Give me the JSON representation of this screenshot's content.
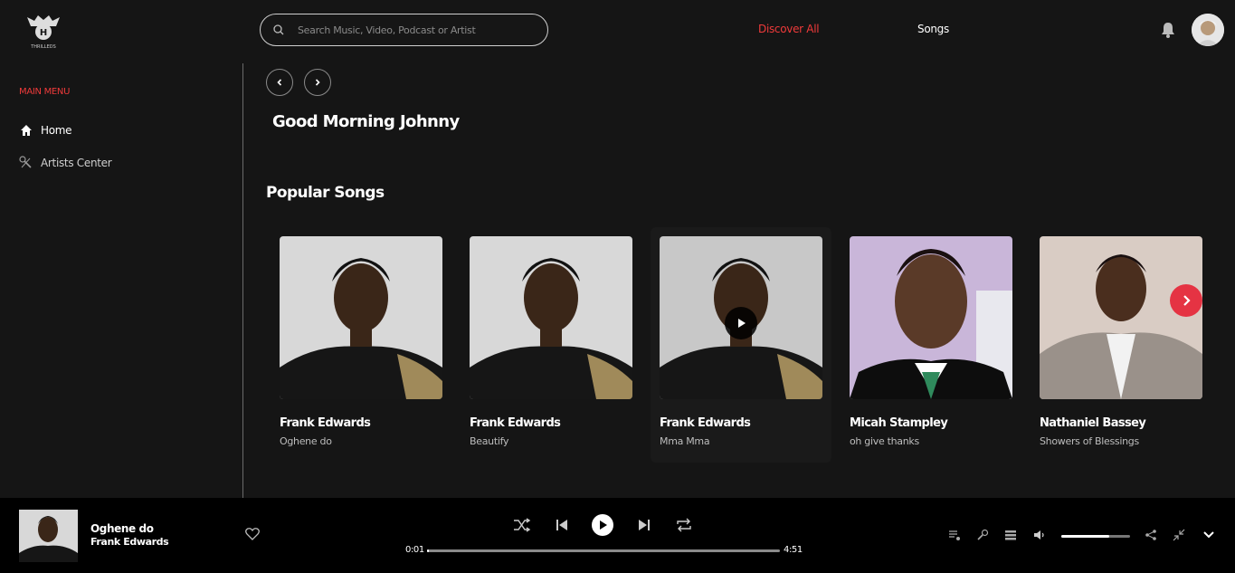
{
  "header": {
    "logo_text": "THRILLEDS",
    "search_placeholder": "Search Music, Video, Podcast or Artist",
    "nav": [
      {
        "label": "Discover All",
        "active": true
      },
      {
        "label": "Songs",
        "active": false
      }
    ]
  },
  "sidebar": {
    "menu_title": "MAIN MENU",
    "items": [
      {
        "label": "Home",
        "icon": "home-icon"
      },
      {
        "label": "Artists Center",
        "icon": "artists-icon"
      }
    ]
  },
  "main": {
    "greeting": "Good Morning Johnny",
    "popular_title": "Popular Songs",
    "songs": [
      {
        "artist": "Frank Edwards",
        "title": "Oghene do"
      },
      {
        "artist": "Frank Edwards",
        "title": "Beautify"
      },
      {
        "artist": "Frank Edwards",
        "title": "Mma Mma"
      },
      {
        "artist": "Micah Stampley",
        "title": "oh give thanks"
      },
      {
        "artist": "Nathaniel Bassey",
        "title": "Showers of Blessings"
      }
    ]
  },
  "player": {
    "now_playing_title": "Oghene do",
    "now_playing_artist": "Frank Edwards",
    "current_time": "0:01",
    "total_time": "4:51",
    "progress_fraction": 0.004,
    "volume_fraction": 0.7
  },
  "colors": {
    "accent": "#ef3a3a",
    "background": "#151515",
    "player_bg": "#000000"
  }
}
